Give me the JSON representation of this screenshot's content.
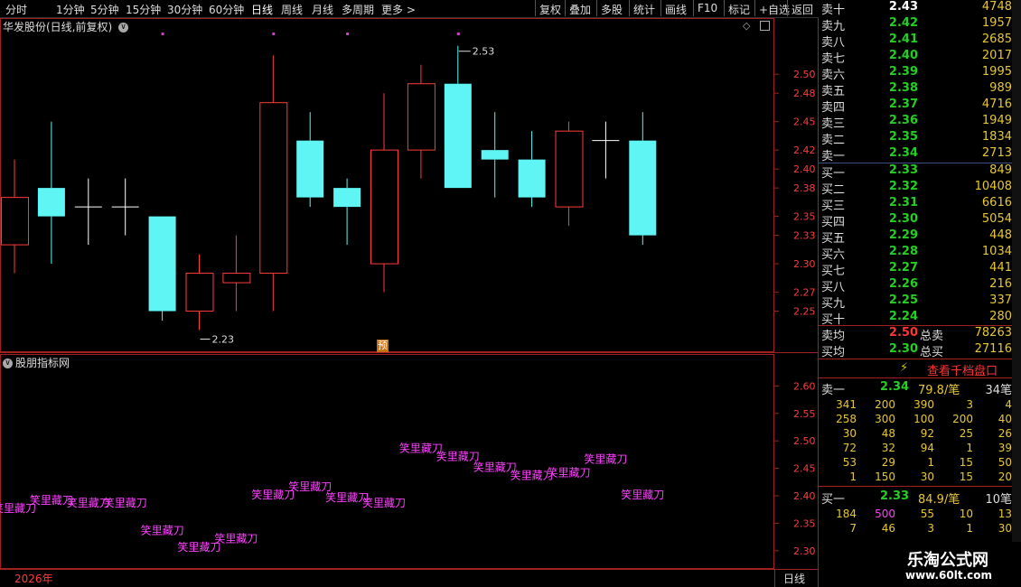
{
  "toolbar": {
    "periods": [
      "分时",
      "1分钟",
      "5分钟",
      "15分钟",
      "30分钟",
      "60分钟",
      "日线",
      "周线",
      "月线",
      "多周期",
      "更多 >"
    ],
    "active_period": "日线",
    "buttons": [
      "复权",
      "叠加",
      "多股",
      "统计",
      "画线",
      "F10",
      "标记",
      "+自选",
      "返回"
    ]
  },
  "stock": {
    "title": "华发股份(日线,前复权)",
    "yu_badge": "预"
  },
  "main_chart": {
    "y_ticks": [
      "2.50",
      "2.48",
      "2.45",
      "2.42",
      "2.40",
      "2.38",
      "2.35",
      "2.33",
      "2.30",
      "2.27",
      "2.25"
    ],
    "y_range": [
      2.22,
      2.545
    ],
    "high_marker": "2.53",
    "low_marker": "2.23",
    "colors": {
      "up": "#ff3b3b",
      "down": "#5ff5f5",
      "flat": "#ffffff",
      "border": "#a02020"
    },
    "candles": [
      {
        "o": 2.32,
        "h": 2.41,
        "l": 2.29,
        "c": 2.37
      },
      {
        "o": 2.38,
        "h": 2.45,
        "l": 2.3,
        "c": 2.35
      },
      {
        "o": 2.36,
        "h": 2.39,
        "l": 2.32,
        "c": 2.36
      },
      {
        "o": 2.36,
        "h": 2.39,
        "l": 2.33,
        "c": 2.36
      },
      {
        "o": 2.35,
        "h": 2.35,
        "l": 2.24,
        "c": 2.25
      },
      {
        "o": 2.25,
        "h": 2.31,
        "l": 2.23,
        "c": 2.29
      },
      {
        "o": 2.28,
        "h": 2.33,
        "l": 2.25,
        "c": 2.29
      },
      {
        "o": 2.29,
        "h": 2.52,
        "l": 2.25,
        "c": 2.47
      },
      {
        "o": 2.43,
        "h": 2.46,
        "l": 2.36,
        "c": 2.37
      },
      {
        "o": 2.38,
        "h": 2.39,
        "l": 2.32,
        "c": 2.36
      },
      {
        "o": 2.3,
        "h": 2.48,
        "l": 2.27,
        "c": 2.42
      },
      {
        "o": 2.42,
        "h": 2.51,
        "l": 2.39,
        "c": 2.49
      },
      {
        "o": 2.49,
        "h": 2.53,
        "l": 2.38,
        "c": 2.38
      },
      {
        "o": 2.42,
        "h": 2.46,
        "l": 2.37,
        "c": 2.41
      },
      {
        "o": 2.41,
        "h": 2.44,
        "l": 2.36,
        "c": 2.37
      },
      {
        "o": 2.36,
        "h": 2.45,
        "l": 2.34,
        "c": 2.44
      },
      {
        "o": 2.43,
        "h": 2.45,
        "l": 2.39,
        "c": 2.43
      },
      {
        "o": 2.43,
        "h": 2.46,
        "l": 2.32,
        "c": 2.33
      }
    ]
  },
  "indicator": {
    "title": "股朋指标网",
    "y_ticks": [
      "2.60",
      "2.55",
      "2.50",
      "2.45",
      "2.40",
      "2.35",
      "2.30"
    ],
    "y_range": [
      2.275,
      2.645
    ],
    "label_text": "笑里藏刀",
    "label_color": "#ff40ff",
    "labels": [
      {
        "i": 0,
        "v": 2.37
      },
      {
        "i": 1,
        "v": 2.385
      },
      {
        "i": 2,
        "v": 2.38
      },
      {
        "i": 3,
        "v": 2.38
      },
      {
        "i": 4,
        "v": 2.33
      },
      {
        "i": 5,
        "v": 2.3
      },
      {
        "i": 6,
        "v": 2.315
      },
      {
        "i": 7,
        "v": 2.395
      },
      {
        "i": 8,
        "v": 2.41
      },
      {
        "i": 9,
        "v": 2.39
      },
      {
        "i": 10,
        "v": 2.38
      },
      {
        "i": 11,
        "v": 2.48
      },
      {
        "i": 12,
        "v": 2.465
      },
      {
        "i": 13,
        "v": 2.445
      },
      {
        "i": 14,
        "v": 2.43
      },
      {
        "i": 15,
        "v": 2.435
      },
      {
        "i": 16,
        "v": 2.46
      },
      {
        "i": 17,
        "v": 2.395
      }
    ],
    "year_label": "2026年",
    "period_label": "日线"
  },
  "orderbook": {
    "asks": [
      {
        "label": "卖十",
        "price": "2.43",
        "vol": "4748"
      },
      {
        "label": "卖九",
        "price": "2.42",
        "vol": "1957"
      },
      {
        "label": "卖八",
        "price": "2.41",
        "vol": "2685"
      },
      {
        "label": "卖七",
        "price": "2.40",
        "vol": "2017"
      },
      {
        "label": "卖六",
        "price": "2.39",
        "vol": "1995"
      },
      {
        "label": "卖五",
        "price": "2.38",
        "vol": "989"
      },
      {
        "label": "卖四",
        "price": "2.37",
        "vol": "4716"
      },
      {
        "label": "卖三",
        "price": "2.36",
        "vol": "1949"
      },
      {
        "label": "卖二",
        "price": "2.35",
        "vol": "1834"
      },
      {
        "label": "卖一",
        "price": "2.34",
        "vol": "2713"
      }
    ],
    "bids": [
      {
        "label": "买一",
        "price": "2.33",
        "vol": "849"
      },
      {
        "label": "买二",
        "price": "2.32",
        "vol": "10408"
      },
      {
        "label": "买三",
        "price": "2.31",
        "vol": "6616"
      },
      {
        "label": "买四",
        "price": "2.30",
        "vol": "5054"
      },
      {
        "label": "买五",
        "price": "2.29",
        "vol": "448"
      },
      {
        "label": "买六",
        "price": "2.28",
        "vol": "1034"
      },
      {
        "label": "买七",
        "price": "2.27",
        "vol": "441"
      },
      {
        "label": "买八",
        "price": "2.26",
        "vol": "216"
      },
      {
        "label": "买九",
        "price": "2.25",
        "vol": "337"
      },
      {
        "label": "买十",
        "price": "2.24",
        "vol": "280"
      }
    ],
    "avg_sell_label": "卖均",
    "avg_sell_price": "2.50",
    "total_sell_label": "总卖",
    "total_sell": "78263",
    "avg_buy_label": "买均",
    "avg_buy_price": "2.30",
    "total_buy_label": "总买",
    "total_buy": "27116",
    "view_button": "查看千档盘口"
  },
  "queue": {
    "sell_label": "卖一",
    "sell_price": "2.34",
    "sell_avg": "79.8/笔",
    "sell_count": "34笔",
    "sell_rows": [
      [
        "341",
        "200",
        "390",
        "3",
        "4"
      ],
      [
        "258",
        "300",
        "100",
        "200",
        "40"
      ],
      [
        "30",
        "48",
        "92",
        "25",
        "26"
      ],
      [
        "72",
        "32",
        "94",
        "1",
        "39"
      ],
      [
        "53",
        "29",
        "1",
        "15",
        "50"
      ],
      [
        "1",
        "150",
        "30",
        "15",
        "20"
      ]
    ],
    "buy_label": "买一",
    "buy_price": "2.33",
    "buy_avg": "84.9/笔",
    "buy_count": "10笔",
    "buy_rows": [
      [
        "184",
        "500",
        "55",
        "10",
        "13"
      ],
      [
        "7",
        "46",
        "3",
        "1",
        "30"
      ]
    ]
  },
  "watermark": {
    "name": "乐淘公式网",
    "url": "www.60lt.com"
  }
}
